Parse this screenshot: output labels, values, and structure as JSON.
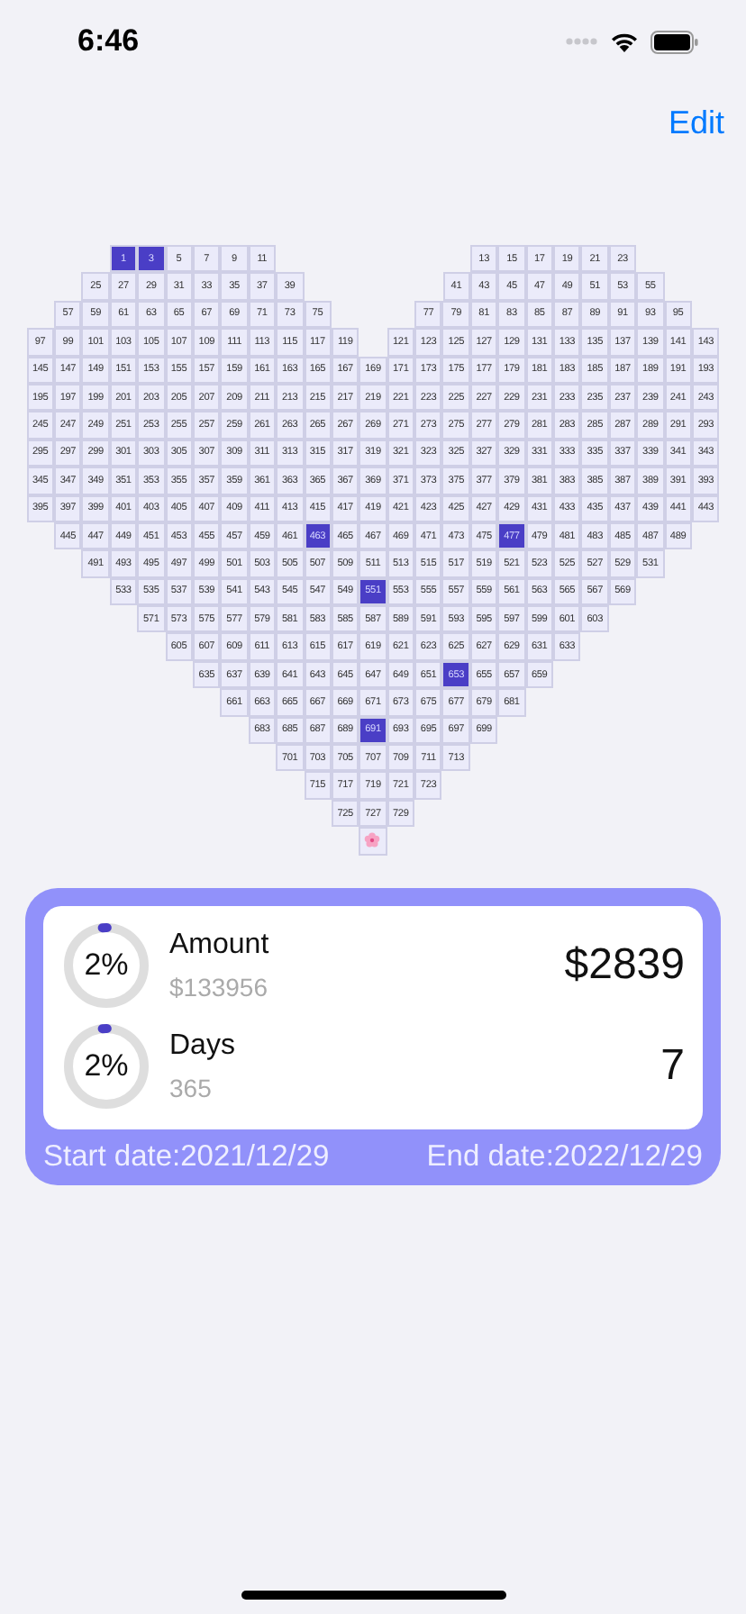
{
  "status_bar": {
    "time": "6:46"
  },
  "nav": {
    "edit": "Edit"
  },
  "grid": [
    {
      "left": [
        {
          "label": "1",
          "selected": true
        },
        {
          "label": "3",
          "selected": true
        },
        {
          "label": "5",
          "selected": false
        },
        {
          "label": "7",
          "selected": false
        },
        {
          "label": "9",
          "selected": false
        },
        {
          "label": "11",
          "selected": false
        }
      ],
      "right": [
        {
          "label": "13",
          "selected": false
        },
        {
          "label": "15",
          "selected": false
        },
        {
          "label": "17",
          "selected": false
        },
        {
          "label": "19",
          "selected": false
        },
        {
          "label": "21",
          "selected": false
        },
        {
          "label": "23",
          "selected": false
        }
      ]
    },
    {
      "left": [
        {
          "label": "25",
          "selected": false
        },
        {
          "label": "27",
          "selected": false
        },
        {
          "label": "29",
          "selected": false
        },
        {
          "label": "31",
          "selected": false
        },
        {
          "label": "33",
          "selected": false
        },
        {
          "label": "35",
          "selected": false
        },
        {
          "label": "37",
          "selected": false
        },
        {
          "label": "39",
          "selected": false
        }
      ],
      "right": [
        {
          "label": "41",
          "selected": false
        },
        {
          "label": "43",
          "selected": false
        },
        {
          "label": "45",
          "selected": false
        },
        {
          "label": "47",
          "selected": false
        },
        {
          "label": "49",
          "selected": false
        },
        {
          "label": "51",
          "selected": false
        },
        {
          "label": "53",
          "selected": false
        },
        {
          "label": "55",
          "selected": false
        }
      ]
    },
    {
      "left": [
        {
          "label": "57",
          "selected": false
        },
        {
          "label": "59",
          "selected": false
        },
        {
          "label": "61",
          "selected": false
        },
        {
          "label": "63",
          "selected": false
        },
        {
          "label": "65",
          "selected": false
        },
        {
          "label": "67",
          "selected": false
        },
        {
          "label": "69",
          "selected": false
        },
        {
          "label": "71",
          "selected": false
        },
        {
          "label": "73",
          "selected": false
        },
        {
          "label": "75",
          "selected": false
        }
      ],
      "right": [
        {
          "label": "77",
          "selected": false
        },
        {
          "label": "79",
          "selected": false
        },
        {
          "label": "81",
          "selected": false
        },
        {
          "label": "83",
          "selected": false
        },
        {
          "label": "85",
          "selected": false
        },
        {
          "label": "87",
          "selected": false
        },
        {
          "label": "89",
          "selected": false
        },
        {
          "label": "91",
          "selected": false
        },
        {
          "label": "93",
          "selected": false
        },
        {
          "label": "95",
          "selected": false
        }
      ]
    },
    {
      "left": [
        {
          "label": "97",
          "selected": false
        },
        {
          "label": "99",
          "selected": false
        },
        {
          "label": "101",
          "selected": false
        },
        {
          "label": "103",
          "selected": false
        },
        {
          "label": "105",
          "selected": false
        },
        {
          "label": "107",
          "selected": false
        },
        {
          "label": "109",
          "selected": false
        },
        {
          "label": "111",
          "selected": false
        },
        {
          "label": "113",
          "selected": false
        },
        {
          "label": "115",
          "selected": false
        },
        {
          "label": "117",
          "selected": false
        },
        {
          "label": "119",
          "selected": false
        }
      ],
      "right": [
        {
          "label": "121",
          "selected": false
        },
        {
          "label": "123",
          "selected": false
        },
        {
          "label": "125",
          "selected": false
        },
        {
          "label": "127",
          "selected": false
        },
        {
          "label": "129",
          "selected": false
        },
        {
          "label": "131",
          "selected": false
        },
        {
          "label": "133",
          "selected": false
        },
        {
          "label": "135",
          "selected": false
        },
        {
          "label": "137",
          "selected": false
        },
        {
          "label": "139",
          "selected": false
        },
        {
          "label": "141",
          "selected": false
        },
        {
          "label": "143",
          "selected": false
        }
      ]
    },
    {
      "cells": [
        {
          "label": "145",
          "selected": false
        },
        {
          "label": "147",
          "selected": false
        },
        {
          "label": "149",
          "selected": false
        },
        {
          "label": "151",
          "selected": false
        },
        {
          "label": "153",
          "selected": false
        },
        {
          "label": "155",
          "selected": false
        },
        {
          "label": "157",
          "selected": false
        },
        {
          "label": "159",
          "selected": false
        },
        {
          "label": "161",
          "selected": false
        },
        {
          "label": "163",
          "selected": false
        },
        {
          "label": "165",
          "selected": false
        },
        {
          "label": "167",
          "selected": false
        },
        {
          "label": "169",
          "selected": false
        },
        {
          "label": "171",
          "selected": false
        },
        {
          "label": "173",
          "selected": false
        },
        {
          "label": "175",
          "selected": false
        },
        {
          "label": "177",
          "selected": false
        },
        {
          "label": "179",
          "selected": false
        },
        {
          "label": "181",
          "selected": false
        },
        {
          "label": "183",
          "selected": false
        },
        {
          "label": "185",
          "selected": false
        },
        {
          "label": "187",
          "selected": false
        },
        {
          "label": "189",
          "selected": false
        },
        {
          "label": "191",
          "selected": false
        },
        {
          "label": "193",
          "selected": false
        }
      ]
    },
    {
      "cells": [
        {
          "label": "195",
          "selected": false
        },
        {
          "label": "197",
          "selected": false
        },
        {
          "label": "199",
          "selected": false
        },
        {
          "label": "201",
          "selected": false
        },
        {
          "label": "203",
          "selected": false
        },
        {
          "label": "205",
          "selected": false
        },
        {
          "label": "207",
          "selected": false
        },
        {
          "label": "209",
          "selected": false
        },
        {
          "label": "211",
          "selected": false
        },
        {
          "label": "213",
          "selected": false
        },
        {
          "label": "215",
          "selected": false
        },
        {
          "label": "217",
          "selected": false
        },
        {
          "label": "219",
          "selected": false
        },
        {
          "label": "221",
          "selected": false
        },
        {
          "label": "223",
          "selected": false
        },
        {
          "label": "225",
          "selected": false
        },
        {
          "label": "227",
          "selected": false
        },
        {
          "label": "229",
          "selected": false
        },
        {
          "label": "231",
          "selected": false
        },
        {
          "label": "233",
          "selected": false
        },
        {
          "label": "235",
          "selected": false
        },
        {
          "label": "237",
          "selected": false
        },
        {
          "label": "239",
          "selected": false
        },
        {
          "label": "241",
          "selected": false
        },
        {
          "label": "243",
          "selected": false
        }
      ]
    },
    {
      "cells": [
        {
          "label": "245",
          "selected": false
        },
        {
          "label": "247",
          "selected": false
        },
        {
          "label": "249",
          "selected": false
        },
        {
          "label": "251",
          "selected": false
        },
        {
          "label": "253",
          "selected": false
        },
        {
          "label": "255",
          "selected": false
        },
        {
          "label": "257",
          "selected": false
        },
        {
          "label": "259",
          "selected": false
        },
        {
          "label": "261",
          "selected": false
        },
        {
          "label": "263",
          "selected": false
        },
        {
          "label": "265",
          "selected": false
        },
        {
          "label": "267",
          "selected": false
        },
        {
          "label": "269",
          "selected": false
        },
        {
          "label": "271",
          "selected": false
        },
        {
          "label": "273",
          "selected": false
        },
        {
          "label": "275",
          "selected": false
        },
        {
          "label": "277",
          "selected": false
        },
        {
          "label": "279",
          "selected": false
        },
        {
          "label": "281",
          "selected": false
        },
        {
          "label": "283",
          "selected": false
        },
        {
          "label": "285",
          "selected": false
        },
        {
          "label": "287",
          "selected": false
        },
        {
          "label": "289",
          "selected": false
        },
        {
          "label": "291",
          "selected": false
        },
        {
          "label": "293",
          "selected": false
        }
      ]
    },
    {
      "cells": [
        {
          "label": "295",
          "selected": false
        },
        {
          "label": "297",
          "selected": false
        },
        {
          "label": "299",
          "selected": false
        },
        {
          "label": "301",
          "selected": false
        },
        {
          "label": "303",
          "selected": false
        },
        {
          "label": "305",
          "selected": false
        },
        {
          "label": "307",
          "selected": false
        },
        {
          "label": "309",
          "selected": false
        },
        {
          "label": "311",
          "selected": false
        },
        {
          "label": "313",
          "selected": false
        },
        {
          "label": "315",
          "selected": false
        },
        {
          "label": "317",
          "selected": false
        },
        {
          "label": "319",
          "selected": false
        },
        {
          "label": "321",
          "selected": false
        },
        {
          "label": "323",
          "selected": false
        },
        {
          "label": "325",
          "selected": false
        },
        {
          "label": "327",
          "selected": false
        },
        {
          "label": "329",
          "selected": false
        },
        {
          "label": "331",
          "selected": false
        },
        {
          "label": "333",
          "selected": false
        },
        {
          "label": "335",
          "selected": false
        },
        {
          "label": "337",
          "selected": false
        },
        {
          "label": "339",
          "selected": false
        },
        {
          "label": "341",
          "selected": false
        },
        {
          "label": "343",
          "selected": false
        }
      ]
    },
    {
      "cells": [
        {
          "label": "345",
          "selected": false
        },
        {
          "label": "347",
          "selected": false
        },
        {
          "label": "349",
          "selected": false
        },
        {
          "label": "351",
          "selected": false
        },
        {
          "label": "353",
          "selected": false
        },
        {
          "label": "355",
          "selected": false
        },
        {
          "label": "357",
          "selected": false
        },
        {
          "label": "359",
          "selected": false
        },
        {
          "label": "361",
          "selected": false
        },
        {
          "label": "363",
          "selected": false
        },
        {
          "label": "365",
          "selected": false
        },
        {
          "label": "367",
          "selected": false
        },
        {
          "label": "369",
          "selected": false
        },
        {
          "label": "371",
          "selected": false
        },
        {
          "label": "373",
          "selected": false
        },
        {
          "label": "375",
          "selected": false
        },
        {
          "label": "377",
          "selected": false
        },
        {
          "label": "379",
          "selected": false
        },
        {
          "label": "381",
          "selected": false
        },
        {
          "label": "383",
          "selected": false
        },
        {
          "label": "385",
          "selected": false
        },
        {
          "label": "387",
          "selected": false
        },
        {
          "label": "389",
          "selected": false
        },
        {
          "label": "391",
          "selected": false
        },
        {
          "label": "393",
          "selected": false
        }
      ]
    },
    {
      "cells": [
        {
          "label": "395",
          "selected": false
        },
        {
          "label": "397",
          "selected": false
        },
        {
          "label": "399",
          "selected": false
        },
        {
          "label": "401",
          "selected": false
        },
        {
          "label": "403",
          "selected": false
        },
        {
          "label": "405",
          "selected": false
        },
        {
          "label": "407",
          "selected": false
        },
        {
          "label": "409",
          "selected": false
        },
        {
          "label": "411",
          "selected": false
        },
        {
          "label": "413",
          "selected": false
        },
        {
          "label": "415",
          "selected": false
        },
        {
          "label": "417",
          "selected": false
        },
        {
          "label": "419",
          "selected": false
        },
        {
          "label": "421",
          "selected": false
        },
        {
          "label": "423",
          "selected": false
        },
        {
          "label": "425",
          "selected": false
        },
        {
          "label": "427",
          "selected": false
        },
        {
          "label": "429",
          "selected": false
        },
        {
          "label": "431",
          "selected": false
        },
        {
          "label": "433",
          "selected": false
        },
        {
          "label": "435",
          "selected": false
        },
        {
          "label": "437",
          "selected": false
        },
        {
          "label": "439",
          "selected": false
        },
        {
          "label": "441",
          "selected": false
        },
        {
          "label": "443",
          "selected": false
        }
      ]
    },
    {
      "cells": [
        {
          "label": "445",
          "selected": false
        },
        {
          "label": "447",
          "selected": false
        },
        {
          "label": "449",
          "selected": false
        },
        {
          "label": "451",
          "selected": false
        },
        {
          "label": "453",
          "selected": false
        },
        {
          "label": "455",
          "selected": false
        },
        {
          "label": "457",
          "selected": false
        },
        {
          "label": "459",
          "selected": false
        },
        {
          "label": "461",
          "selected": false
        },
        {
          "label": "463",
          "selected": true
        },
        {
          "label": "465",
          "selected": false
        },
        {
          "label": "467",
          "selected": false
        },
        {
          "label": "469",
          "selected": false
        },
        {
          "label": "471",
          "selected": false
        },
        {
          "label": "473",
          "selected": false
        },
        {
          "label": "475",
          "selected": false
        },
        {
          "label": "477",
          "selected": true
        },
        {
          "label": "479",
          "selected": false
        },
        {
          "label": "481",
          "selected": false
        },
        {
          "label": "483",
          "selected": false
        },
        {
          "label": "485",
          "selected": false
        },
        {
          "label": "487",
          "selected": false
        },
        {
          "label": "489",
          "selected": false
        }
      ]
    },
    {
      "cells": [
        {
          "label": "491",
          "selected": false
        },
        {
          "label": "493",
          "selected": false
        },
        {
          "label": "495",
          "selected": false
        },
        {
          "label": "497",
          "selected": false
        },
        {
          "label": "499",
          "selected": false
        },
        {
          "label": "501",
          "selected": false
        },
        {
          "label": "503",
          "selected": false
        },
        {
          "label": "505",
          "selected": false
        },
        {
          "label": "507",
          "selected": false
        },
        {
          "label": "509",
          "selected": false
        },
        {
          "label": "511",
          "selected": false
        },
        {
          "label": "513",
          "selected": false
        },
        {
          "label": "515",
          "selected": false
        },
        {
          "label": "517",
          "selected": false
        },
        {
          "label": "519",
          "selected": false
        },
        {
          "label": "521",
          "selected": false
        },
        {
          "label": "523",
          "selected": false
        },
        {
          "label": "525",
          "selected": false
        },
        {
          "label": "527",
          "selected": false
        },
        {
          "label": "529",
          "selected": false
        },
        {
          "label": "531",
          "selected": false
        }
      ]
    },
    {
      "cells": [
        {
          "label": "533",
          "selected": false
        },
        {
          "label": "535",
          "selected": false
        },
        {
          "label": "537",
          "selected": false
        },
        {
          "label": "539",
          "selected": false
        },
        {
          "label": "541",
          "selected": false
        },
        {
          "label": "543",
          "selected": false
        },
        {
          "label": "545",
          "selected": false
        },
        {
          "label": "547",
          "selected": false
        },
        {
          "label": "549",
          "selected": false
        },
        {
          "label": "551",
          "selected": true
        },
        {
          "label": "553",
          "selected": false
        },
        {
          "label": "555",
          "selected": false
        },
        {
          "label": "557",
          "selected": false
        },
        {
          "label": "559",
          "selected": false
        },
        {
          "label": "561",
          "selected": false
        },
        {
          "label": "563",
          "selected": false
        },
        {
          "label": "565",
          "selected": false
        },
        {
          "label": "567",
          "selected": false
        },
        {
          "label": "569",
          "selected": false
        }
      ]
    },
    {
      "cells": [
        {
          "label": "571",
          "selected": false
        },
        {
          "label": "573",
          "selected": false
        },
        {
          "label": "575",
          "selected": false
        },
        {
          "label": "577",
          "selected": false
        },
        {
          "label": "579",
          "selected": false
        },
        {
          "label": "581",
          "selected": false
        },
        {
          "label": "583",
          "selected": false
        },
        {
          "label": "585",
          "selected": false
        },
        {
          "label": "587",
          "selected": false
        },
        {
          "label": "589",
          "selected": false
        },
        {
          "label": "591",
          "selected": false
        },
        {
          "label": "593",
          "selected": false
        },
        {
          "label": "595",
          "selected": false
        },
        {
          "label": "597",
          "selected": false
        },
        {
          "label": "599",
          "selected": false
        },
        {
          "label": "601",
          "selected": false
        },
        {
          "label": "603",
          "selected": false
        }
      ]
    },
    {
      "cells": [
        {
          "label": "605",
          "selected": false
        },
        {
          "label": "607",
          "selected": false
        },
        {
          "label": "609",
          "selected": false
        },
        {
          "label": "611",
          "selected": false
        },
        {
          "label": "613",
          "selected": false
        },
        {
          "label": "615",
          "selected": false
        },
        {
          "label": "617",
          "selected": false
        },
        {
          "label": "619",
          "selected": false
        },
        {
          "label": "621",
          "selected": false
        },
        {
          "label": "623",
          "selected": false
        },
        {
          "label": "625",
          "selected": false
        },
        {
          "label": "627",
          "selected": false
        },
        {
          "label": "629",
          "selected": false
        },
        {
          "label": "631",
          "selected": false
        },
        {
          "label": "633",
          "selected": false
        }
      ]
    },
    {
      "cells": [
        {
          "label": "635",
          "selected": false
        },
        {
          "label": "637",
          "selected": false
        },
        {
          "label": "639",
          "selected": false
        },
        {
          "label": "641",
          "selected": false
        },
        {
          "label": "643",
          "selected": false
        },
        {
          "label": "645",
          "selected": false
        },
        {
          "label": "647",
          "selected": false
        },
        {
          "label": "649",
          "selected": false
        },
        {
          "label": "651",
          "selected": false
        },
        {
          "label": "653",
          "selected": true
        },
        {
          "label": "655",
          "selected": false
        },
        {
          "label": "657",
          "selected": false
        },
        {
          "label": "659",
          "selected": false
        }
      ]
    },
    {
      "cells": [
        {
          "label": "661",
          "selected": false
        },
        {
          "label": "663",
          "selected": false
        },
        {
          "label": "665",
          "selected": false
        },
        {
          "label": "667",
          "selected": false
        },
        {
          "label": "669",
          "selected": false
        },
        {
          "label": "671",
          "selected": false
        },
        {
          "label": "673",
          "selected": false
        },
        {
          "label": "675",
          "selected": false
        },
        {
          "label": "677",
          "selected": false
        },
        {
          "label": "679",
          "selected": false
        },
        {
          "label": "681",
          "selected": false
        }
      ]
    },
    {
      "cells": [
        {
          "label": "683",
          "selected": false
        },
        {
          "label": "685",
          "selected": false
        },
        {
          "label": "687",
          "selected": false
        },
        {
          "label": "689",
          "selected": false
        },
        {
          "label": "691",
          "selected": true
        },
        {
          "label": "693",
          "selected": false
        },
        {
          "label": "695",
          "selected": false
        },
        {
          "label": "697",
          "selected": false
        },
        {
          "label": "699",
          "selected": false
        }
      ]
    },
    {
      "cells": [
        {
          "label": "701",
          "selected": false
        },
        {
          "label": "703",
          "selected": false
        },
        {
          "label": "705",
          "selected": false
        },
        {
          "label": "707",
          "selected": false
        },
        {
          "label": "709",
          "selected": false
        },
        {
          "label": "711",
          "selected": false
        },
        {
          "label": "713",
          "selected": false
        }
      ]
    },
    {
      "cells": [
        {
          "label": "715",
          "selected": false
        },
        {
          "label": "717",
          "selected": false
        },
        {
          "label": "719",
          "selected": false
        },
        {
          "label": "721",
          "selected": false
        },
        {
          "label": "723",
          "selected": false
        }
      ]
    },
    {
      "cells": [
        {
          "label": "725",
          "selected": false
        },
        {
          "label": "727",
          "selected": false
        },
        {
          "label": "729",
          "selected": false
        }
      ]
    },
    {
      "cells": [
        {
          "kind": "flower",
          "selected": false
        }
      ]
    }
  ],
  "summary": {
    "stats": [
      {
        "percent": "2%",
        "level": 0.02,
        "title": "Amount",
        "total": "$133956",
        "value": "$2839"
      },
      {
        "percent": "2%",
        "level": 0.02,
        "title": "Days",
        "total": "365",
        "value": "7"
      }
    ],
    "start": "Start date:2021/12/29",
    "end": "End date:2022/12/29"
  }
}
